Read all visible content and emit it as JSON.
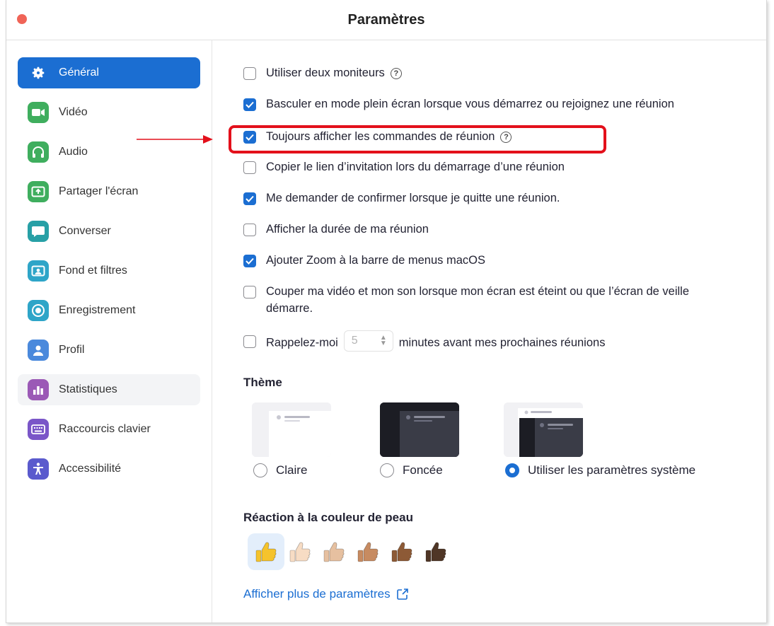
{
  "window": {
    "title": "Paramètres"
  },
  "sidebar": {
    "items": [
      {
        "label": "Général",
        "icon": "gear-icon",
        "color": "#1b6ed2",
        "active": true
      },
      {
        "label": "Vidéo",
        "icon": "video-camera-icon",
        "color": "#3fae5e"
      },
      {
        "label": "Audio",
        "icon": "headphones-icon",
        "color": "#3fae5e"
      },
      {
        "label": "Partager l'écran",
        "icon": "share-screen-icon",
        "color": "#3fae5e"
      },
      {
        "label": "Converser",
        "icon": "chat-bubble-icon",
        "color": "#27a0a6"
      },
      {
        "label": "Fond et filtres",
        "icon": "background-portrait-icon",
        "color": "#2ea5c8"
      },
      {
        "label": "Enregistrement",
        "icon": "record-icon",
        "color": "#2ea5c8"
      },
      {
        "label": "Profil",
        "icon": "profile-icon",
        "color": "#4a89dc"
      },
      {
        "label": "Statistiques",
        "icon": "bar-chart-icon",
        "color": "#9b59b6"
      },
      {
        "label": "Raccourcis clavier",
        "icon": "keyboard-icon",
        "color": "#7a56c8"
      },
      {
        "label": "Accessibilité",
        "icon": "accessibility-icon",
        "color": "#5a5acd"
      }
    ]
  },
  "general": {
    "options": [
      {
        "label": "Utiliser deux moniteurs",
        "checked": false,
        "help": true
      },
      {
        "label": "Basculer en mode plein écran lorsque vous démarrez ou rejoignez une réunion",
        "checked": true
      },
      {
        "label": "Toujours afficher les commandes de réunion",
        "checked": true,
        "help": true
      },
      {
        "label": "Copier le lien d’invitation lors du démarrage d’une réunion",
        "checked": false
      },
      {
        "label": "Me demander de confirmer lorsque je quitte une réunion.",
        "checked": true
      },
      {
        "label": "Afficher la durée de ma réunion",
        "checked": false
      },
      {
        "label": "Ajouter Zoom à la barre de menus macOS",
        "checked": true
      },
      {
        "label": "Couper ma vidéo et mon son lorsque mon écran est éteint ou que l’écran de veille démarre.",
        "checked": false
      },
      {
        "label": "Rappelez-moi",
        "checked": false
      }
    ],
    "reminder": {
      "minutes": "5",
      "suffix": "minutes avant mes prochaines réunions"
    },
    "help_glyph": "?"
  },
  "theme": {
    "title": "Thème",
    "options": [
      {
        "label": "Claire",
        "checked": false
      },
      {
        "label": "Foncée",
        "checked": false
      },
      {
        "label": "Utiliser les paramètres système",
        "checked": true
      }
    ]
  },
  "skin_tone": {
    "title": "Réaction à la couleur de peau",
    "tones": [
      "#f5c32c",
      "#f7dcc4",
      "#e6c0a0",
      "#c78b61",
      "#8d5a36",
      "#4f3626"
    ],
    "selected_index": 0
  },
  "more_link": {
    "label": "Afficher plus de paramètres"
  },
  "colors": {
    "accent": "#1b6ed2",
    "highlight": "#e3101b"
  }
}
